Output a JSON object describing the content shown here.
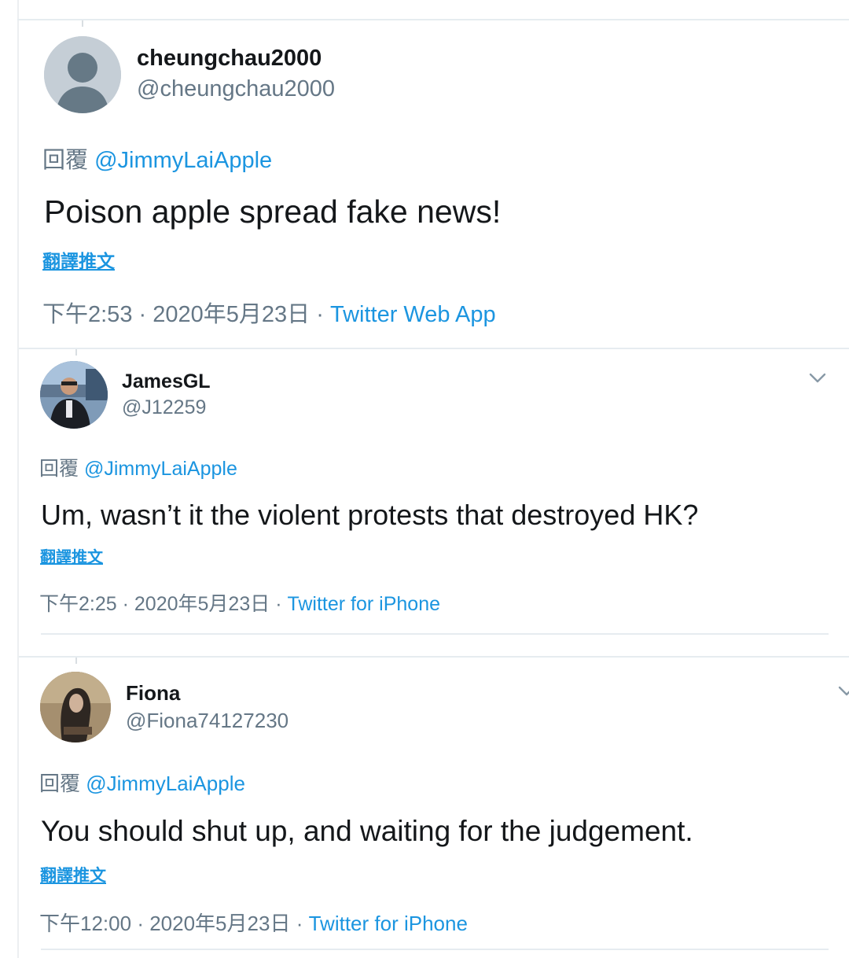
{
  "tweets": [
    {
      "display_name": "cheungchau2000",
      "handle": "@cheungchau2000",
      "reply_prefix": "回覆",
      "reply_to": "@JimmyLaiApple",
      "text": "Poison apple spread fake news!",
      "translate_label": "翻譯推文",
      "time": "下午2:53",
      "dot": "·",
      "date": "2020年5月23日",
      "source": "Twitter Web App",
      "avatar": "default-avatar-icon"
    },
    {
      "display_name": "JamesGL",
      "handle": "@J12259",
      "reply_prefix": "回覆",
      "reply_to": "@JimmyLaiApple",
      "text": "Um, wasn’t it the violent protests that destroyed HK?",
      "translate_label": "翻譯推文",
      "time": "下午2:25",
      "dot": "·",
      "date": "2020年5月23日",
      "source": "Twitter for iPhone",
      "avatar": "user-photo-avatar"
    },
    {
      "display_name": "Fiona",
      "handle": "@Fiona74127230",
      "reply_prefix": "回覆",
      "reply_to": "@JimmyLaiApple",
      "text": "You should shut up, and waiting for the judgement.",
      "translate_label": "翻譯推文",
      "time": "下午12:00",
      "dot": "·",
      "date": "2020年5月23日",
      "source": "Twitter for iPhone",
      "avatar": "user-photo-avatar"
    }
  ],
  "colors": {
    "link": "#1b95e0",
    "secondary_text": "#657786",
    "primary_text": "#14171a",
    "divider": "#e6ecf0"
  }
}
